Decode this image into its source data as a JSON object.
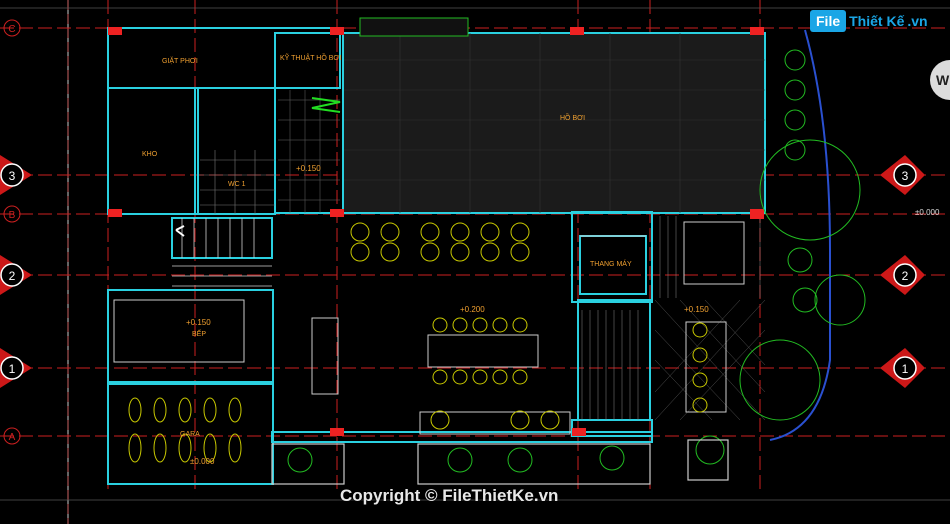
{
  "watermark": "Copyright © FileThietKe.vn",
  "logo": {
    "box": "File",
    "rest": "Thiết Kế",
    "suffix": ".vn"
  },
  "compass_letter": "W",
  "grid_labels": [
    "C",
    "3",
    "B",
    "2",
    "1",
    "A"
  ],
  "rooms": {
    "laundry": "GIẶT PHƠI",
    "pool_tech": "KỸ THUẬT HỒ BƠI",
    "pool": "HỒ BƠI",
    "storage": "KHO",
    "wc": "WC 1",
    "kitchen": "BẾP",
    "elevator": "THANG MÁY",
    "garage": "GARA"
  },
  "levels": {
    "wc": "+0.150",
    "kitchen": "+0.150",
    "dining": "+0.200",
    "terrace": "+0.150",
    "garage": "±0.000",
    "right": "±0.000"
  }
}
